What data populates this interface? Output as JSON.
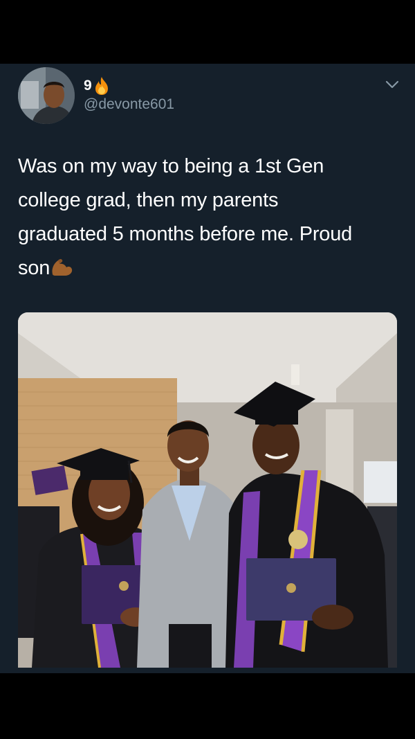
{
  "tweet": {
    "display_name": "9",
    "handle": "@devonte601",
    "text_lines": [
      "Was on my way to being a 1st Gen",
      "college grad, then my parents",
      "graduated 5 months before me. Proud",
      "son"
    ],
    "name_emoji": "fire-icon",
    "text_emoji": "flexed-biceps-icon",
    "menu_icon": "chevron-down-icon"
  },
  "theme": {
    "background": "#15202b",
    "text": "#ffffff",
    "secondary_text": "#8899a6"
  },
  "media": {
    "type": "photo"
  }
}
